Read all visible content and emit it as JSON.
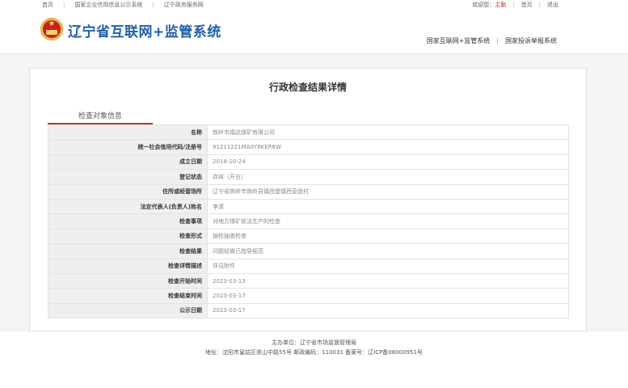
{
  "topbar": {
    "links": [
      "首页",
      "国家企业信用信息公示系统",
      "辽宁政务服务网"
    ],
    "welcome": "欢迎您：",
    "user": "主勤",
    "home": "首页",
    "logout": "退出"
  },
  "header": {
    "title": "辽宁省互联网+监管系统",
    "links": [
      "国家互联网+监管系统",
      "国家投诉举报系统"
    ]
  },
  "page_title": "行政检查结果详情",
  "section_tab": "检查对象信息",
  "rows": [
    {
      "label": "名称",
      "value": "铁岭市福达煤矿有限公司"
    },
    {
      "label": "统一社会信用代码/注册号",
      "value": "91211221MA0Y8KER6W"
    },
    {
      "label": "成立日期",
      "value": "2018-10-24"
    },
    {
      "label": "登记状态",
      "value": "存续（开业）"
    },
    {
      "label": "住所或经营场所",
      "value": "辽宁省铁岭市铁岭县镇西堡镇西营盘村"
    },
    {
      "label": "法定代表人(负责人)姓名",
      "value": "李清"
    },
    {
      "label": "检查事项",
      "value": "对地方煤矿依法生产的检查"
    },
    {
      "label": "检查形式",
      "value": "抽检抽查检查"
    },
    {
      "label": "检查结果",
      "value": "问题轻微已指导规范"
    },
    {
      "label": "检查详情描述",
      "value": "详见附件"
    },
    {
      "label": "检查开始时间",
      "value": "2023-03-13"
    },
    {
      "label": "检查结束时间",
      "value": "2023-03-17"
    },
    {
      "label": "公示日期",
      "value": "2023-03-17"
    }
  ],
  "footer": {
    "line1": "主办单位：辽宁省市场监督管理局",
    "line2": "地址：沈阳市皇姑区崇山中路55号 邮政编码：110031 备案号：辽ICP备08000951号"
  },
  "colors": {
    "brand_blue": "#1f5fa8",
    "accent_red": "#c0392b"
  }
}
